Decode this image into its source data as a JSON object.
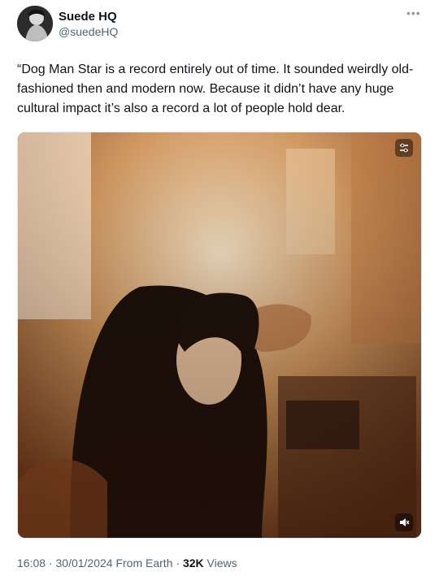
{
  "author": {
    "name": "Suede HQ",
    "handle": "@suedeHQ"
  },
  "tweet": {
    "text": "“Dog Man Star is a record entirely out of time. It sounded weirdly old-fashioned then and modern now. Because it didn’t have any huge cultural impact it’s also a record a lot of people hold dear."
  },
  "meta": {
    "time": "16:08",
    "date": "30/01/2024",
    "source": "From Earth",
    "views_count": "32K",
    "views_label": "Views",
    "separator": "·"
  },
  "icons": {
    "more": "more-options-icon",
    "media_top": "settings-icon",
    "media_bottom": "volume-muted-icon"
  }
}
